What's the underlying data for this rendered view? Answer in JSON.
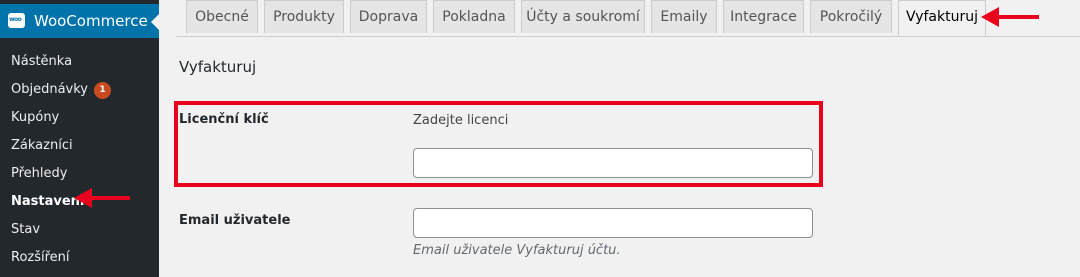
{
  "sidebar": {
    "brand": "WooCommerce",
    "brand_logo": "woo",
    "items": [
      {
        "label": "Nástěnka"
      },
      {
        "label": "Objednávky",
        "badge": "1"
      },
      {
        "label": "Kupóny"
      },
      {
        "label": "Zákazníci"
      },
      {
        "label": "Přehledy"
      },
      {
        "label": "Nastavení",
        "active": true
      },
      {
        "label": "Stav"
      },
      {
        "label": "Rozšíření"
      }
    ]
  },
  "tabs": [
    {
      "label": "Obecné"
    },
    {
      "label": "Produkty"
    },
    {
      "label": "Doprava"
    },
    {
      "label": "Pokladna"
    },
    {
      "label": "Účty a soukromí"
    },
    {
      "label": "Emaily"
    },
    {
      "label": "Integrace"
    },
    {
      "label": "Pokročilý"
    },
    {
      "label": "Vyfakturuj",
      "active": true
    }
  ],
  "page": {
    "title": "Vyfakturuj",
    "license": {
      "label": "Licenční klíč",
      "description": "Zadejte licenci",
      "value": ""
    },
    "email": {
      "label": "Email uživatele",
      "value": "",
      "help": "Email uživatele Vyfakturuj účtu."
    }
  },
  "colors": {
    "sidebar_bg": "#23282d",
    "brand_bg": "#0073aa",
    "badge": "#ca4a1f",
    "annotation_red": "#e8001c"
  }
}
